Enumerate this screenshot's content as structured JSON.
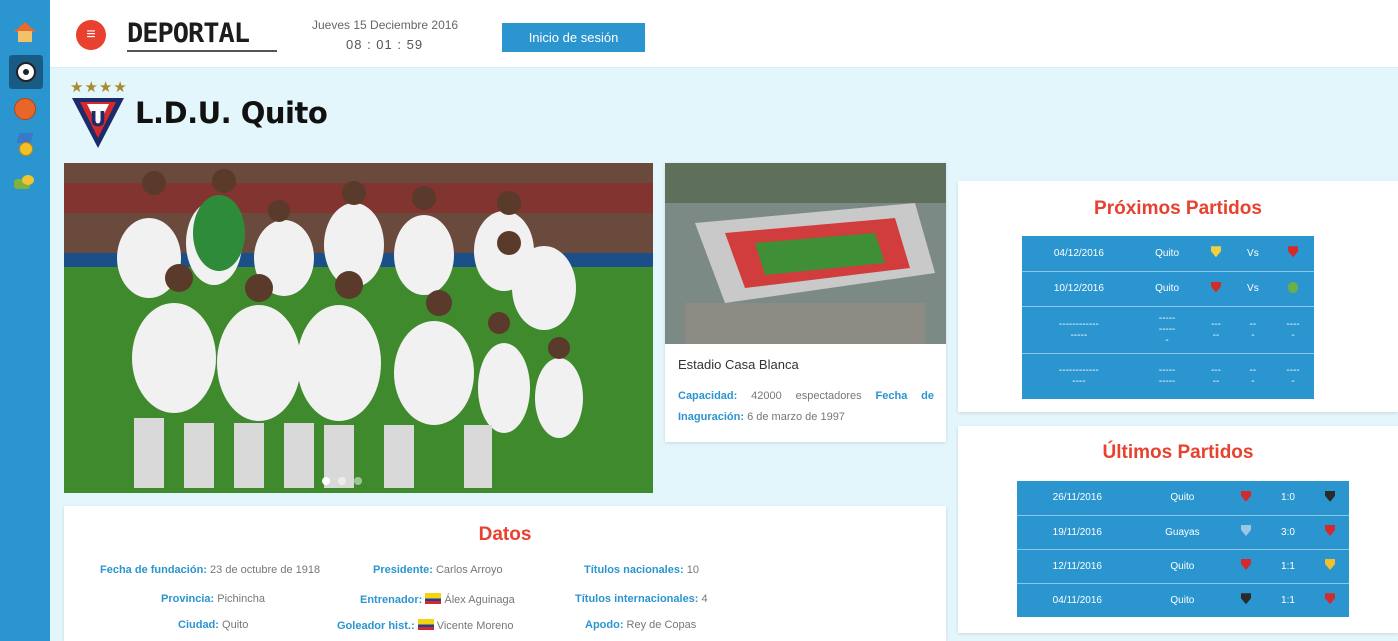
{
  "sidebar": {
    "items": [
      {
        "icon": "home-icon"
      },
      {
        "icon": "soccer-ball-icon"
      },
      {
        "icon": "basketball-icon"
      },
      {
        "icon": "medal-icon"
      },
      {
        "icon": "trophy-icon"
      }
    ]
  },
  "header": {
    "logo": "DEPORTAL",
    "date": "Jueves 15 Deciembre 2016",
    "time": "08 : 01 : 59",
    "login_label": "Inicio de sesión"
  },
  "team": {
    "stars": "★★★★",
    "name": "L.D.U. Quito",
    "crest_letter": "U"
  },
  "stadium": {
    "name": "Estadio Casa Blanca",
    "capacity_label": "Capacidad:",
    "capacity_value": "42000 espectadores",
    "inauguration_label": "Fecha de Inaguración:",
    "inauguration_value": "6 de marzo de 1997"
  },
  "datos": {
    "title": "Datos",
    "fields": [
      {
        "label": "Fecha de fundación:",
        "value": "23 de octubre de 1918"
      },
      {
        "label": "Presidente:",
        "value": "Carlos Arroyo"
      },
      {
        "label": "Títulos nacionales:",
        "value": "10"
      },
      {
        "label": "Provincia:",
        "value": "Pichincha"
      },
      {
        "label": "Entrenador:",
        "value": "Álex Aguinaga"
      },
      {
        "label": "Títulos internacionales:",
        "value": "4"
      },
      {
        "label": "Ciudad:",
        "value": "Quito"
      },
      {
        "label": "Goleador hist.:",
        "value": "Vicente Moreno"
      },
      {
        "label": "Apodo:",
        "value": "Rey de Copas"
      }
    ]
  },
  "proximos": {
    "title": "Próximos Partidos",
    "rows": [
      {
        "date": "04/12/2016",
        "city": "Quito",
        "vs": "Vs"
      },
      {
        "date": "10/12/2016",
        "city": "Quito",
        "vs": "Vs"
      },
      {
        "date": "------------",
        "date2": "-----",
        "city": "-----",
        "city2": "-----",
        "city3": "-",
        "c3": "---",
        "c3b": "--",
        "c4": "--",
        "c4b": "-",
        "c5": "----",
        "c5b": "-"
      },
      {
        "date": "------------",
        "date2": "----",
        "city": "-----",
        "city2": "-----",
        "c3": "---",
        "c3b": "--",
        "c4": "--",
        "c4b": "-",
        "c5": "----",
        "c5b": "-"
      }
    ]
  },
  "ultimos": {
    "title": "Últimos Partidos",
    "rows": [
      {
        "date": "26/11/2016",
        "city": "Quito",
        "score": "1:0"
      },
      {
        "date": "19/11/2016",
        "city": "Guayas",
        "score": "3:0"
      },
      {
        "date": "12/11/2016",
        "city": "Quito",
        "score": "1:1"
      },
      {
        "date": "04/11/2016",
        "city": "Quito",
        "score": "1:1"
      }
    ]
  },
  "colors": {
    "primary": "#2b95cf",
    "accent": "#e8412f",
    "background": "#e3f6fb"
  }
}
